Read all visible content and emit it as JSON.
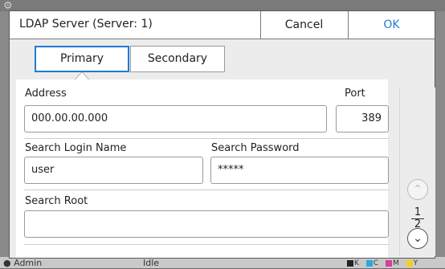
{
  "background": {
    "status_user": "Admin",
    "status_state": "Idle",
    "ink_labels": [
      "K",
      "C",
      "M",
      "Y"
    ],
    "ink_colors": [
      "#222222",
      "#2aa6e0",
      "#d43f9a",
      "#f2d21c"
    ]
  },
  "dialog": {
    "title": "LDAP Server (Server: 1)",
    "cancel_label": "Cancel",
    "ok_label": "OK",
    "tabs": [
      {
        "label": "Primary",
        "selected": true
      },
      {
        "label": "Secondary",
        "selected": false
      }
    ],
    "address_label": "Address",
    "address_value": "000.00.00.000",
    "port_label": "Port",
    "port_value": "389",
    "login_label": "Search Login Name",
    "login_value": "user",
    "password_label": "Search Password",
    "password_value": "*****",
    "root_label": "Search Root",
    "root_value": ""
  },
  "pager": {
    "current": "1",
    "total": "2",
    "up_icon": "chevron-up-icon",
    "down_icon": "chevron-down-icon"
  },
  "colors": {
    "accent": "#1e7bd2"
  }
}
